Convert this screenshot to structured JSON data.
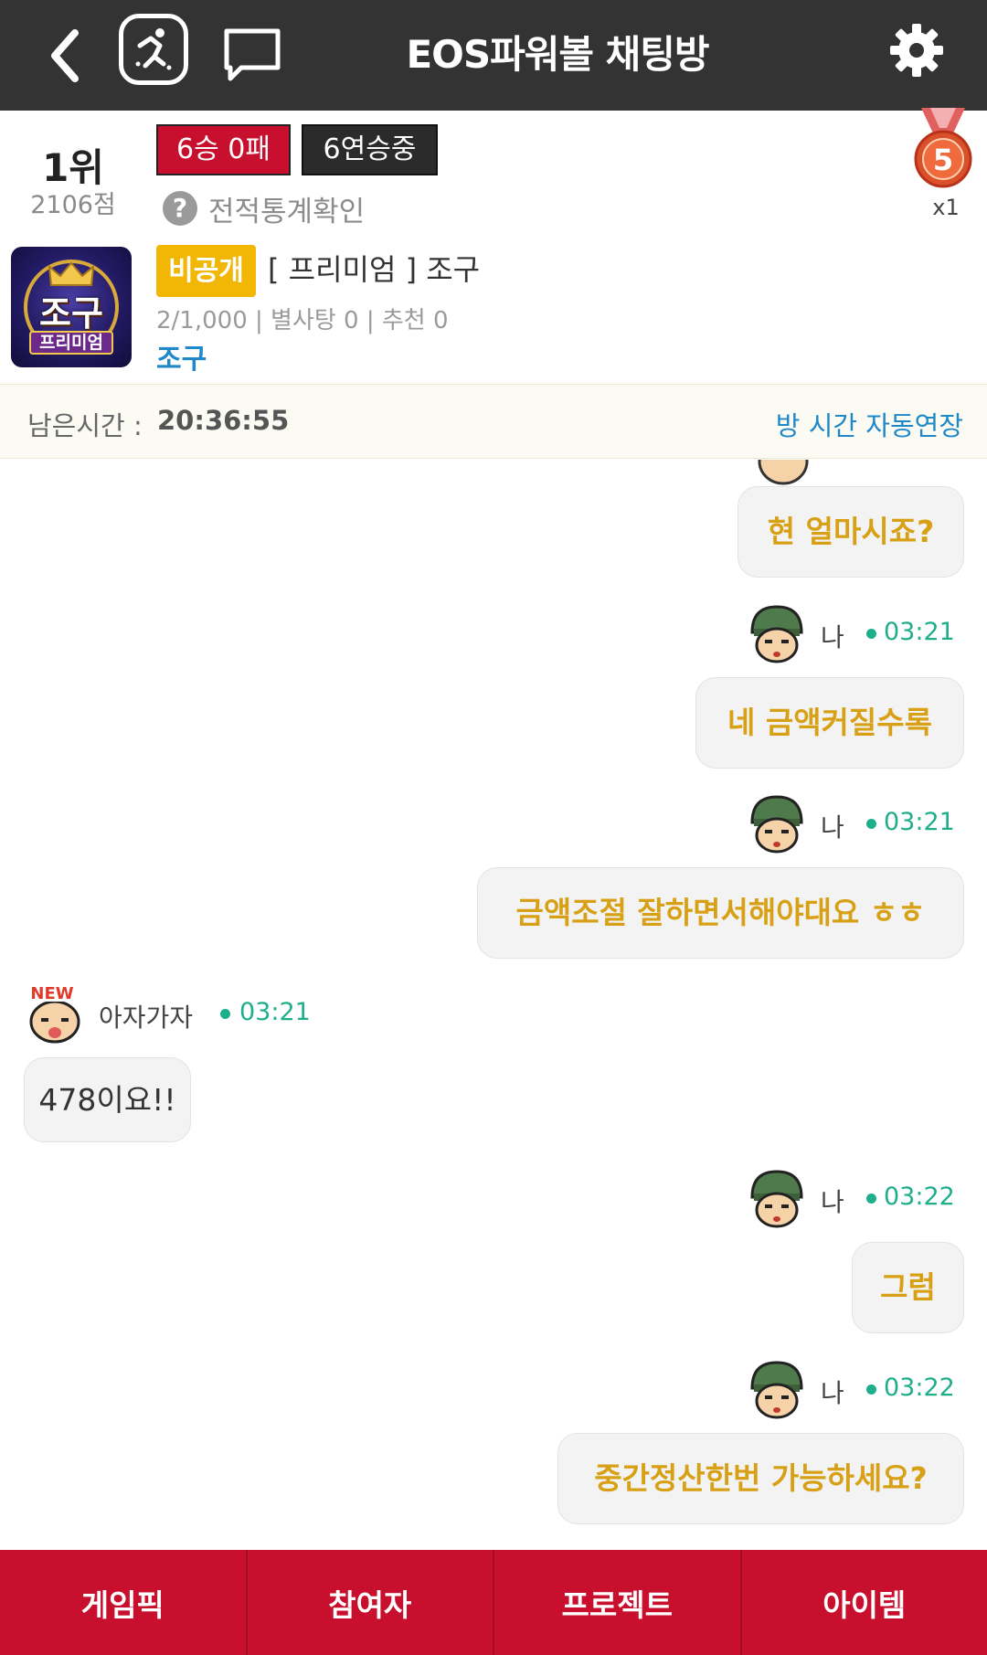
{
  "header": {
    "title": "EOS파워볼 채팅방",
    "icons": [
      "back-arrow-icon",
      "running-person-icon",
      "chat-bubble-icon",
      "gear-icon"
    ]
  },
  "profile": {
    "rank": "1위",
    "points": "2106점",
    "record": "6승 0패",
    "streak": "6연승중",
    "stats_link": "전적통계확인",
    "stats_help_glyph": "?",
    "medal_number": "5",
    "medal_count": "x1"
  },
  "room": {
    "avatar_name": "조구",
    "avatar_tag": "프리미엄",
    "privacy_badge": "비공개",
    "title": "[ 프리미엄 ] 조구",
    "stats": "2/1,000 | 별사탕 0 | 추천 0",
    "owner": "조구"
  },
  "timer": {
    "label": "남은시간 :",
    "value": "20:36:55",
    "extend_link": "방 시간 자동연장"
  },
  "chat": {
    "messages": [
      {
        "from": "me",
        "text": "현 얼마시죠?"
      },
      {
        "from": "me",
        "sender": "나",
        "time": "03:21",
        "text": "네 금액커질수록"
      },
      {
        "from": "me",
        "sender": "나",
        "time": "03:21",
        "text": "금액조절 잘하면서해야대요 ㅎㅎ"
      },
      {
        "from": "other",
        "sender": "아자가자",
        "time": "03:21",
        "avatar_badge": "NEW",
        "text": "478이요!!"
      },
      {
        "from": "me",
        "sender": "나",
        "time": "03:22",
        "text": "그럼"
      },
      {
        "from": "me",
        "sender": "나",
        "time": "03:22",
        "text": "중간정산한번 가능하세요?"
      }
    ]
  },
  "bottom_nav": {
    "items": [
      "게임픽",
      "참여자",
      "프로젝트",
      "아이템"
    ]
  },
  "colors": {
    "topbar": "#333333",
    "accent_red": "#c8102e",
    "my_message_text": "#d7a015",
    "time_green": "#1fae8a",
    "link_blue": "#1e88c8",
    "private_badge": "#f2b705"
  }
}
